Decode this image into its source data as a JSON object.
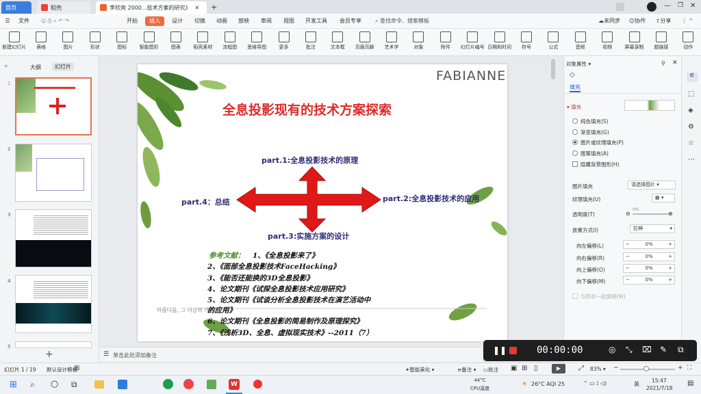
{
  "tabs": [
    {
      "label": "首页"
    },
    {
      "label": "稻壳"
    },
    {
      "label": "李欣亮 2000...技术方案的研究》"
    }
  ],
  "menu": {
    "file": "文件",
    "items": [
      "开始",
      "插入",
      "设计",
      "切换",
      "动画",
      "放映",
      "审阅",
      "视图",
      "开发工具",
      "会员专享"
    ],
    "active": "插入",
    "search": "查找命令、搜索模板",
    "sync": "未同步",
    "collab": "协作",
    "share": "分享"
  },
  "ribbon": [
    "新建幻灯片",
    "表格",
    "图片",
    "形状",
    "图标",
    "智能图形",
    "图表",
    "稻壳素材",
    "流程图",
    "思维导图",
    "更多",
    "批注",
    "文本框",
    "页眉页脚",
    "艺术字",
    "对象",
    "附件",
    "幻灯片编号",
    "日期和时间",
    "符号",
    "公式",
    "音频",
    "视频",
    "屏幕录制",
    "超链接",
    "动作"
  ],
  "leftpane": {
    "tab_outline": "大纲",
    "tab_slides": "幻灯片",
    "numbers": [
      "1",
      "2",
      "3",
      "4",
      "5"
    ]
  },
  "slide": {
    "logo": "FABIANNE",
    "title": "全息投影现有的技术方案探索",
    "parts": {
      "p1": "part.1:全息投影技术的原理",
      "p2": "part.2:全息投影技术的应用",
      "p3": "part.3:实施方案的设计",
      "p4": "part.4：总结"
    },
    "refs_label": "参考文献：",
    "refs": [
      "1、《全息投影来了》",
      "2、《面部全息投影技术FaceHacking》",
      "3、《能否还能换的3D全息投影》",
      "4、论文期刊《试探全息投影技术应用研究》",
      "5、论文期刊《试谈分析全息投影技术在演艺活动中",
      "的应用》",
      "6、论文期刊《全息投影的简易制作及原理探究》",
      "7、《浅析3D、全息、虚拟现实技术》--2011（7）"
    ],
    "korean": "아름다움, 그 이상의 가치"
  },
  "notes": "单击此处添加备注",
  "rightpane": {
    "title": "对象属性",
    "tab": "填充",
    "section": "填充",
    "options": [
      {
        "label": "纯色填充(S)",
        "on": false
      },
      {
        "label": "渐变填充(G)",
        "on": false
      },
      {
        "label": "图片或纹理填充(P)",
        "on": true
      },
      {
        "label": "图案填充(A)",
        "on": false
      }
    ],
    "hide_bg": "隐藏背景图形(H)",
    "pic_fill": "图片填充",
    "pic_fill_val": "请选择图片",
    "texture": "纹理填充(U)",
    "transparency": "透明度(T)",
    "transparency_val": "0%",
    "placement": "放置方式(I)",
    "placement_val": "拉伸",
    "offsets": [
      {
        "label": "向左偏移(L)",
        "val": "0%"
      },
      {
        "label": "向右偏移(R)",
        "val": "0%"
      },
      {
        "label": "向上偏移(O)",
        "val": "0%"
      },
      {
        "label": "向下偏移(M)",
        "val": "0%"
      }
    ],
    "rotate": "与形状一起旋转(W)"
  },
  "status": {
    "slide": "幻灯片 1 / 19",
    "template": "默认设计模板",
    "beautify": "智能美化",
    "notes": "备注",
    "comments": "批注",
    "zoom": "83%"
  },
  "recorder": {
    "time": "00:00:00"
  },
  "taskbar": {
    "temp": "44°C",
    "cpu": "CPU温度",
    "weather": "26°C AQI 25",
    "lang": "英",
    "time": "15:47",
    "date": "2021/7/18"
  }
}
